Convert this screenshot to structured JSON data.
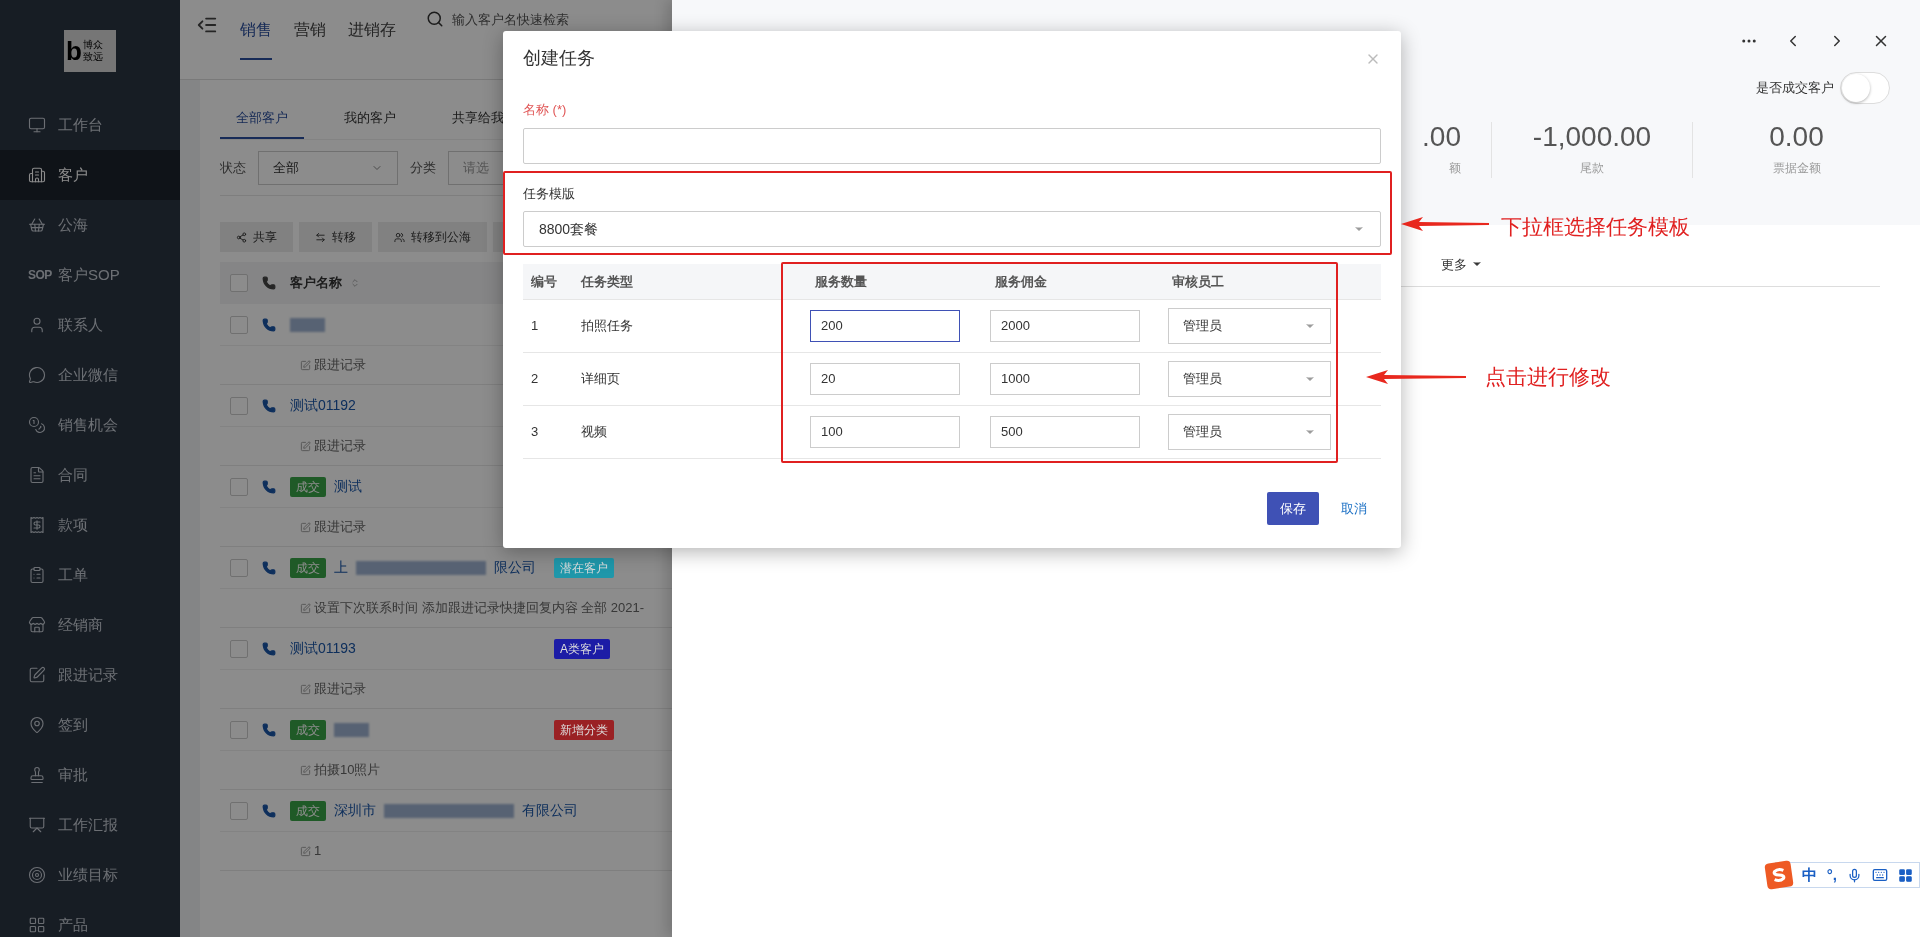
{
  "sidebar": {
    "logo": {
      "letter": "b",
      "lines": [
        "博众",
        "致远"
      ]
    },
    "items": [
      {
        "label": "工作台",
        "selected": false
      },
      {
        "label": "客户",
        "selected": true
      },
      {
        "label": "公海",
        "selected": false
      },
      {
        "label": "客户SOP",
        "icon_text": "SOP",
        "selected": false
      },
      {
        "label": "联系人",
        "selected": false
      },
      {
        "label": "企业微信",
        "selected": false
      },
      {
        "label": "销售机会",
        "selected": false
      },
      {
        "label": "合同",
        "selected": false
      },
      {
        "label": "款项",
        "selected": false
      },
      {
        "label": "工单",
        "selected": false
      },
      {
        "label": "经销商",
        "selected": false
      },
      {
        "label": "跟进记录",
        "selected": false
      },
      {
        "label": "签到",
        "selected": false
      },
      {
        "label": "审批",
        "selected": false
      },
      {
        "label": "工作汇报",
        "selected": false
      },
      {
        "label": "业绩目标",
        "selected": false
      },
      {
        "label": "产品",
        "selected": false
      }
    ]
  },
  "topbar": {
    "tabs": [
      {
        "label": "销售",
        "selected": true
      },
      {
        "label": "营销",
        "selected": false
      },
      {
        "label": "进销存",
        "selected": false
      }
    ],
    "search": {
      "placeholder": "输入客户名快速检索"
    }
  },
  "customers": {
    "tabs": [
      {
        "label": "全部客户",
        "selected": true
      },
      {
        "label": "我的客户",
        "selected": false
      },
      {
        "label": "共享给我",
        "selected": false
      }
    ],
    "filters": [
      {
        "label": "状态",
        "value": "全部"
      },
      {
        "label": "分类",
        "placeholder": "请选"
      }
    ],
    "actions": [
      "共享",
      "转移",
      "转移到公海"
    ],
    "columns": [
      "客户名称"
    ],
    "all_checked": false,
    "rows": [
      {
        "checked": false,
        "deal": false,
        "blurred": true,
        "note": "跟进记录"
      },
      {
        "checked": false,
        "deal": false,
        "blurred": false,
        "name": "测试01192",
        "note": "跟进记录"
      },
      {
        "checked": false,
        "deal": true,
        "deal_label": "成交",
        "blurred": false,
        "name": "测试",
        "note": "跟进记录"
      },
      {
        "checked": false,
        "deal": true,
        "deal_label": "成交",
        "blurred": true,
        "name": "上",
        "name_end": "限公司",
        "tag": {
          "label": "潜在客户",
          "color": "#1f97aa"
        },
        "note": "设置下次联系时间 添加跟进记录快捷回复内容 全部 2021-"
      },
      {
        "checked": false,
        "deal": false,
        "blurred": false,
        "name": "测试01193",
        "tag": {
          "label": "A类客户",
          "color": "#1c1ca6"
        },
        "note": "跟进记录"
      },
      {
        "checked": false,
        "deal": true,
        "deal_label": "成交",
        "blurred": true,
        "tag": {
          "label": "新增分类",
          "color": "#9a2124"
        },
        "note": "拍摄10照片"
      },
      {
        "checked": false,
        "deal": true,
        "deal_label": "成交",
        "blurred": true,
        "name": "深圳市",
        "name_end": "有限公司",
        "note": "1"
      }
    ]
  },
  "drawer": {
    "deal_toggle": {
      "label": "是否成交客户",
      "on": false
    },
    "stats": [
      {
        "value": ".00",
        "label": "额"
      },
      {
        "value": "-1,000.00",
        "label": "尾款"
      },
      {
        "value": "0.00",
        "label": "票据金额"
      }
    ],
    "tabs": [
      {
        "label": "更多"
      }
    ]
  },
  "modal": {
    "title": "创建任务",
    "name_field": {
      "label": "名称 (*)"
    },
    "template": {
      "label": "任务模版",
      "value": "8800套餐"
    },
    "table": {
      "columns": [
        "编号",
        "任务类型",
        "服务数量",
        "服务佣金",
        "审核员工"
      ],
      "rows": [
        {
          "no": "1",
          "type": "拍照任务",
          "quantity": "200",
          "commission": "2000",
          "reviewer": "管理员",
          "focused": true
        },
        {
          "no": "2",
          "type": "详细页",
          "quantity": "20",
          "commission": "1000",
          "reviewer": "管理员",
          "focused": false
        },
        {
          "no": "3",
          "type": "视频",
          "quantity": "100",
          "commission": "500",
          "reviewer": "管理员",
          "focused": false
        }
      ]
    },
    "buttons": [
      {
        "label": "保存",
        "kind": "primary"
      },
      {
        "label": "取消",
        "kind": "link"
      }
    ]
  },
  "annotations": [
    {
      "text": "下拉框选择任务模板"
    },
    {
      "text": "点击进行修改"
    }
  ],
  "ime": {
    "items": [
      "中",
      "°,"
    ]
  }
}
